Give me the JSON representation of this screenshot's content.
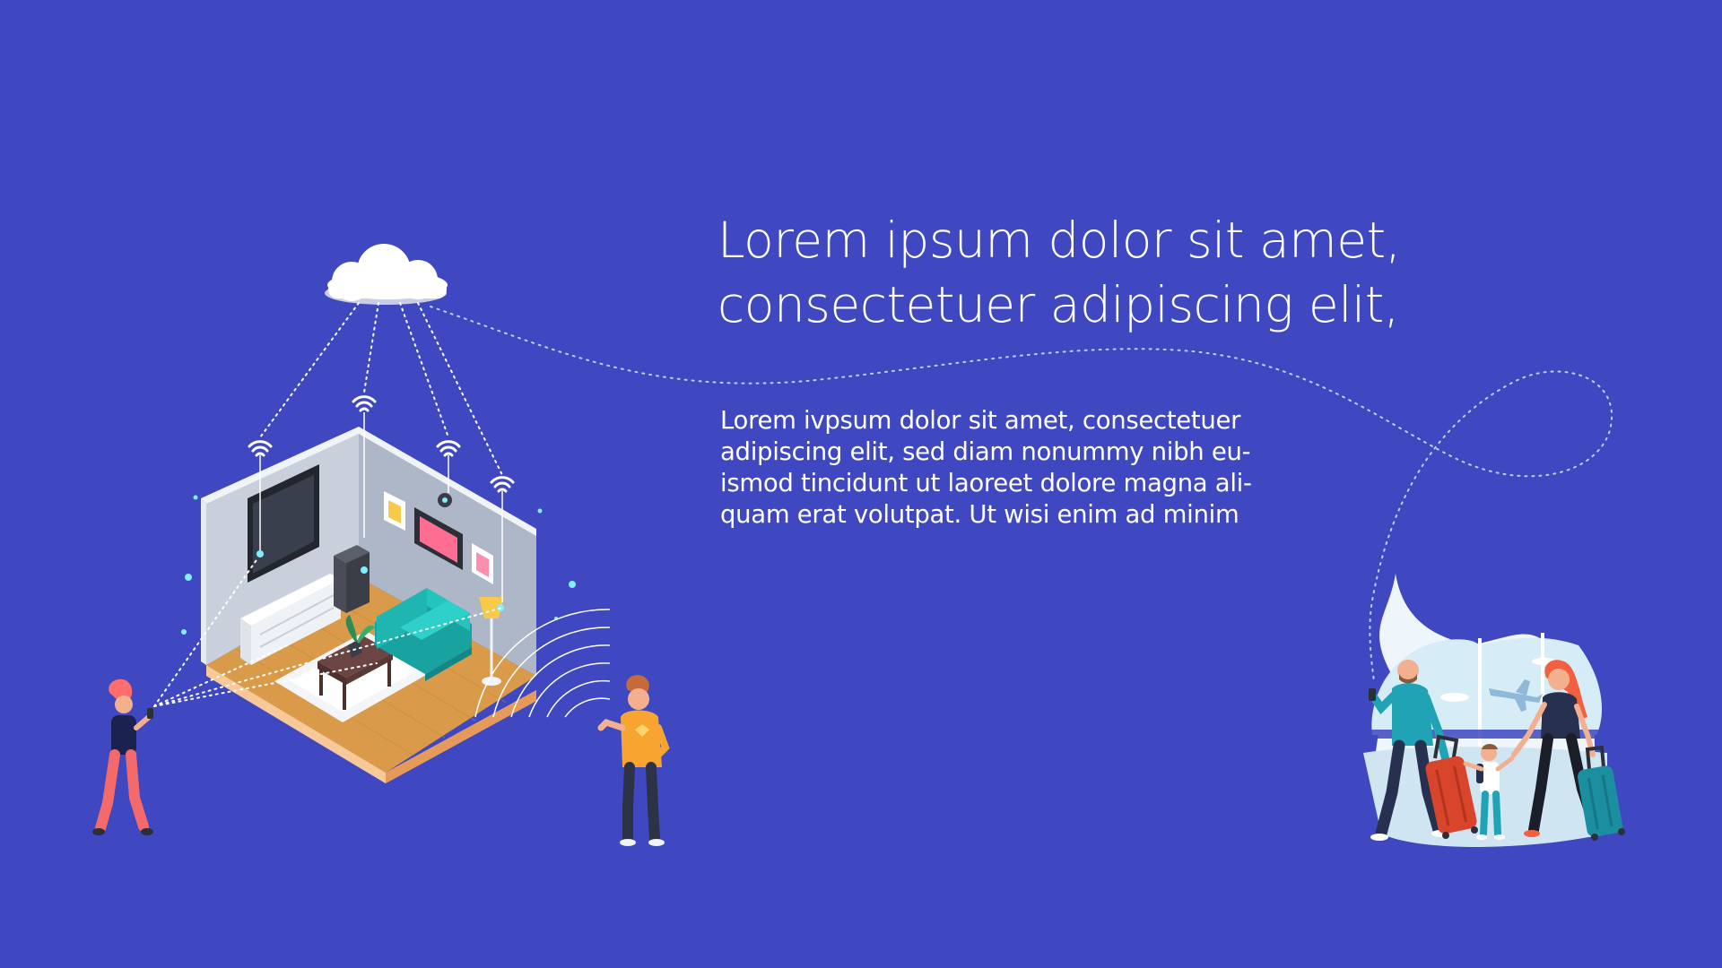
{
  "heading": {
    "line1": "Lorem ipsum dolor sit amet,",
    "line2": "consectetuer adipiscing elit,"
  },
  "body": {
    "line1": "Lorem ivpsum dolor sit amet, consectetuer",
    "line2": "adipiscing elit, sed diam nonummy nibh eu-",
    "line3": "ismod tincidunt ut laoreet dolore magna ali-",
    "line4": "quam erat volutpat. Ut wisi enim ad minim"
  },
  "colors": {
    "background": "#3f48c1",
    "text": "#ffffff",
    "teal_sofa": "#1fb5b0",
    "floor_wood": "#d99a4a",
    "wall": "#c9d0dc"
  },
  "illustrations": {
    "left": [
      "cloud-icon",
      "wifi-icon",
      "smart-home-room",
      "woman-with-phone",
      "man-gesturing"
    ],
    "right": [
      "airport-window",
      "airplane-icon",
      "traveling-family",
      "suitcase-icon"
    ]
  }
}
